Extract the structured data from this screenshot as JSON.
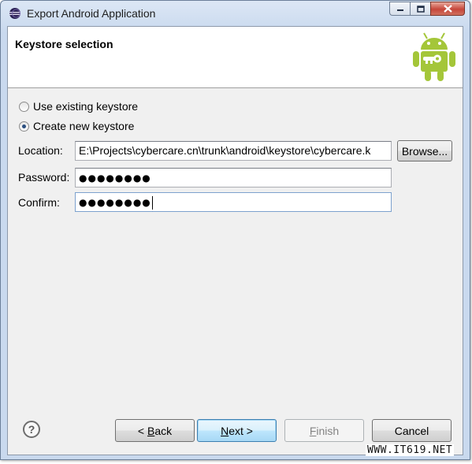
{
  "window": {
    "title": "Export Android Application",
    "minimize": "minimize",
    "maximize": "maximize",
    "close": "close"
  },
  "header": {
    "title": "Keystore selection",
    "logo_icon": "android-robot-icon"
  },
  "options": [
    {
      "label": "Use existing keystore",
      "checked": false
    },
    {
      "label": "Create new keystore",
      "checked": true
    }
  ],
  "form": {
    "location_label": "Location:",
    "location_value": "E:\\Projects\\cybercare.cn\\trunk\\android\\keystore\\cybercare.k",
    "browse_label": "Browse...",
    "password_label": "Password:",
    "password_value": "●●●●●●●●",
    "confirm_label": "Confirm:",
    "confirm_value": "●●●●●●●●"
  },
  "buttons": {
    "help": "?",
    "back_prefix": "< ",
    "back_mnemonic": "B",
    "back_rest": "ack",
    "next_mnemonic": "N",
    "next_rest": "ext >",
    "finish_mnemonic": "F",
    "finish_rest": "inish",
    "cancel": "Cancel"
  },
  "watermark": "WWW.IT619.NET",
  "colors": {
    "android_green": "#a4c639",
    "title_bar": "#c9d9ee",
    "close_red": "#c6463a"
  }
}
